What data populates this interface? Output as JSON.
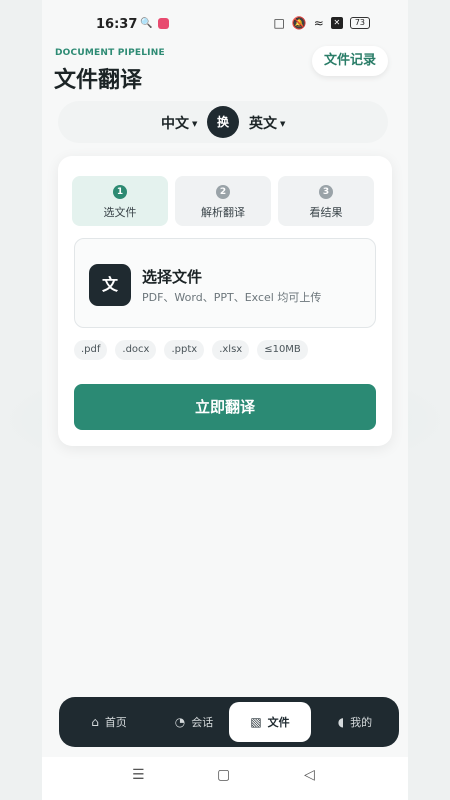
{
  "status_bar": {
    "time": "16:37",
    "battery": "73",
    "icons": [
      "search-icon",
      "app-icon",
      "nfc-icon",
      "mute-icon",
      "wifi-icon",
      "x-box-icon",
      "battery-icon"
    ]
  },
  "header": {
    "eyebrow": "DOCUMENT PIPELINE",
    "title": "文件翻译",
    "records_button": "文件记录"
  },
  "language_bar": {
    "source": "中文",
    "swap": "换",
    "target": "英文"
  },
  "steps": [
    {
      "num": "1",
      "label": "选文件",
      "active": true
    },
    {
      "num": "2",
      "label": "解析翻译",
      "active": false
    },
    {
      "num": "3",
      "label": "看结果",
      "active": false
    }
  ],
  "upload": {
    "icon_glyph": "文",
    "title": "选择文件",
    "subtitle": "PDF、Word、PPT、Excel 均可上传"
  },
  "chips": [
    ".pdf",
    ".docx",
    ".pptx",
    ".xlsx",
    "≤10MB"
  ],
  "cta": "立即翻译",
  "bottom_nav": [
    {
      "icon": "⌂",
      "label": "首页"
    },
    {
      "icon": "◔",
      "label": "会话"
    },
    {
      "icon": "▧",
      "label": "文件"
    },
    {
      "icon": "◖",
      "label": "我的"
    }
  ],
  "colors": {
    "accent": "#2b8a74",
    "dark": "#1f2a30",
    "active_step_bg": "#e4f2ee"
  }
}
